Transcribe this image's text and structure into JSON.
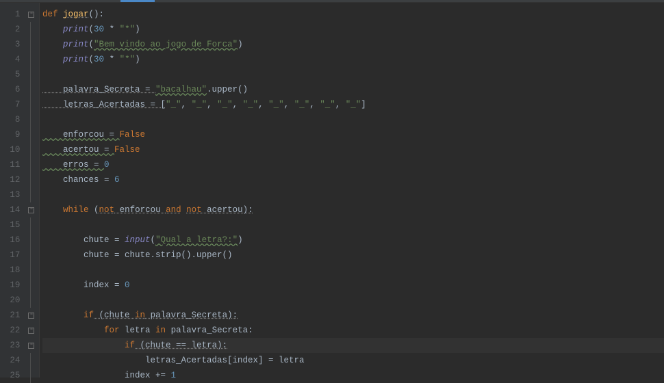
{
  "colors": {
    "background": "#2b2b2b",
    "gutter": "#313335",
    "keyword": "#cc7832",
    "function": "#ffc66d",
    "builtin": "#8888c6",
    "string": "#6a8759",
    "number": "#6897bb",
    "text": "#a9b7c6",
    "line_num": "#606366",
    "current_line": "#323232"
  },
  "current_line_number": 23,
  "lines": {
    "1": {
      "tokens": [
        "def ",
        "jogar",
        "():"
      ]
    },
    "2": {
      "tokens": [
        "    ",
        "print",
        "(",
        "30",
        " * ",
        "\"*\"",
        ")"
      ]
    },
    "3": {
      "tokens": [
        "    ",
        "print",
        "(",
        "\"Bem vindo ao jogo de Forca\"",
        ")"
      ]
    },
    "4": {
      "tokens": [
        "    ",
        "print",
        "(",
        "30",
        " * ",
        "\"*\"",
        ")"
      ]
    },
    "5": {
      "tokens": []
    },
    "6": {
      "tokens": [
        "    palavra_Secreta = ",
        "\"bacalhau\"",
        ".upper()"
      ]
    },
    "7": {
      "tokens": [
        "    letras_Acertadas = [",
        "\"_\"",
        ", ",
        "\"_\"",
        ", ",
        "\"_\"",
        ", ",
        "\"_\"",
        ", ",
        "\"_\"",
        ", ",
        "\"_\"",
        ", ",
        "\"_\"",
        ", ",
        "\"_\"",
        "]"
      ]
    },
    "8": {
      "tokens": []
    },
    "9": {
      "tokens": [
        "    enforcou = ",
        "False"
      ]
    },
    "10": {
      "tokens": [
        "    acertou = ",
        "False"
      ]
    },
    "11": {
      "tokens": [
        "    erros = ",
        "0"
      ]
    },
    "12": {
      "tokens": [
        "    chances = ",
        "6"
      ]
    },
    "13": {
      "tokens": []
    },
    "14": {
      "tokens": [
        "    ",
        "while",
        " (",
        "not",
        " enforcou ",
        "and",
        " ",
        "not",
        " acertou):"
      ]
    },
    "15": {
      "tokens": []
    },
    "16": {
      "tokens": [
        "        chute = ",
        "input",
        "(",
        "\"Qual a letra?:\"",
        ")"
      ]
    },
    "17": {
      "tokens": [
        "        chute = chute.strip().upper()"
      ]
    },
    "18": {
      "tokens": []
    },
    "19": {
      "tokens": [
        "        index = ",
        "0"
      ]
    },
    "20": {
      "tokens": []
    },
    "21": {
      "tokens": [
        "        ",
        "if",
        " (chute ",
        "in",
        " palavra_Secreta):"
      ]
    },
    "22": {
      "tokens": [
        "            ",
        "for",
        " letra ",
        "in",
        " palavra_Secreta:"
      ]
    },
    "23": {
      "tokens": [
        "                ",
        "if",
        " (chute == letra):"
      ]
    },
    "24": {
      "tokens": [
        "                    letras_Acertadas[index] = letra"
      ]
    },
    "25": {
      "tokens": [
        "                index += ",
        "1"
      ]
    }
  },
  "line_numbers": [
    "1",
    "2",
    "3",
    "4",
    "5",
    "6",
    "7",
    "8",
    "9",
    "10",
    "11",
    "12",
    "13",
    "14",
    "15",
    "16",
    "17",
    "18",
    "19",
    "20",
    "21",
    "22",
    "23",
    "24",
    "25"
  ],
  "fold_marks": {
    "1": "open",
    "14": "open",
    "21": "open",
    "22": "open",
    "23": "open"
  }
}
